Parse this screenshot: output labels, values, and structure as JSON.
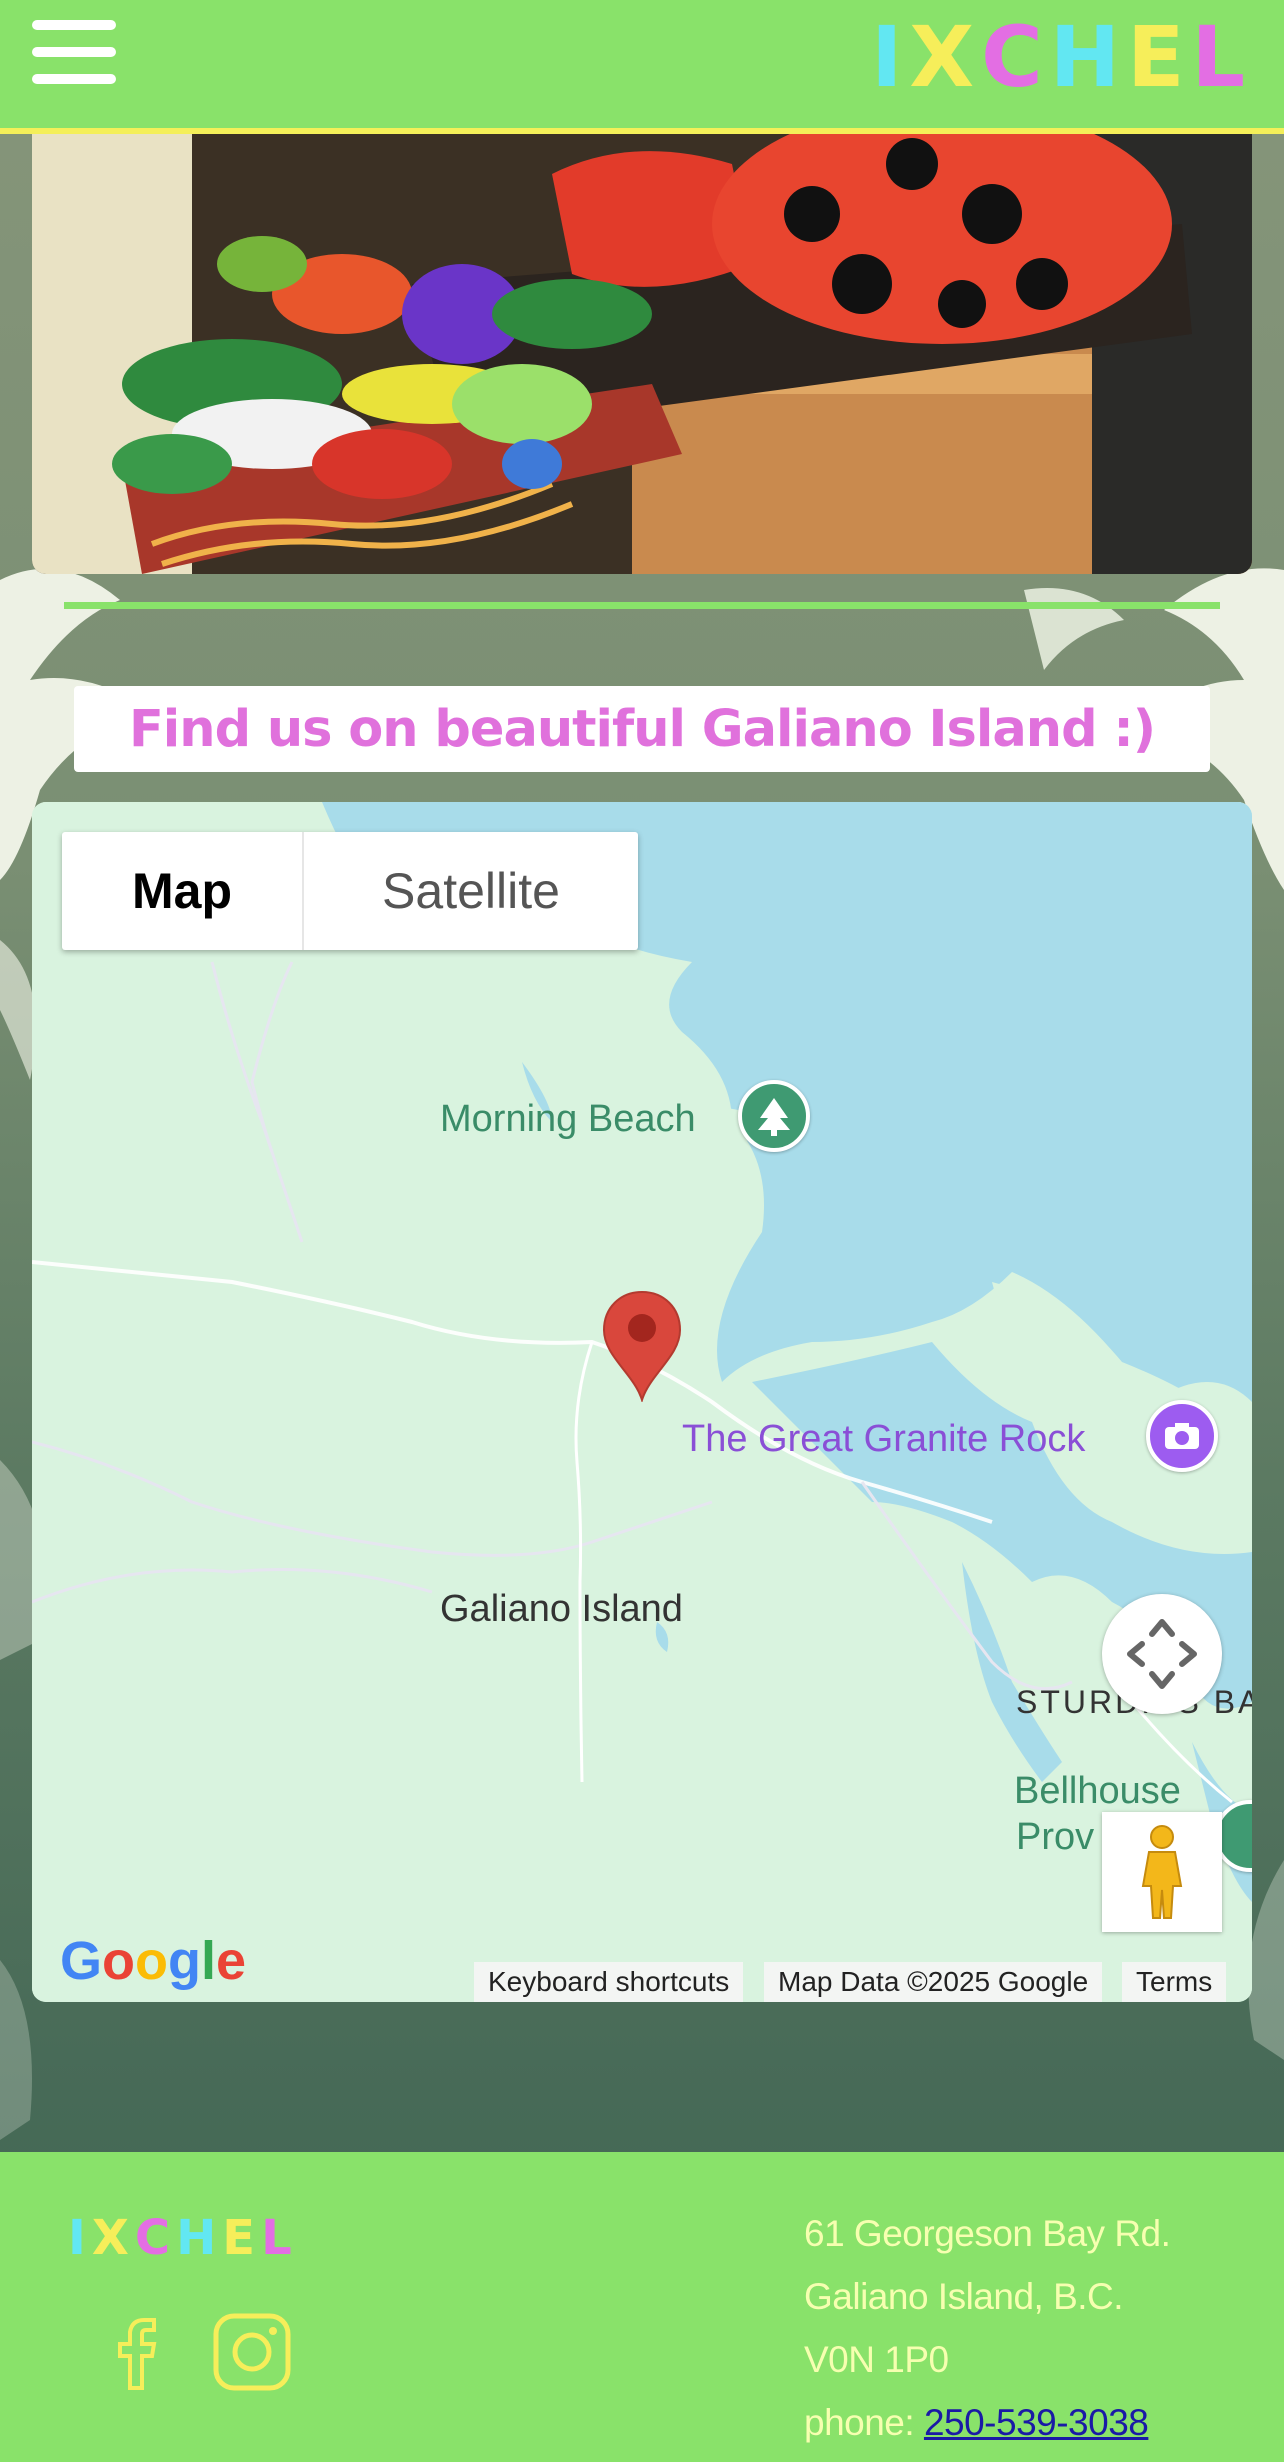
{
  "header": {
    "menu_icon": "hamburger-icon",
    "logo_letters": [
      {
        "char": "I",
        "color": "#62e7f2"
      },
      {
        "char": "X",
        "color": "#f6ee5a"
      },
      {
        "char": "C",
        "color": "#e36ee3"
      },
      {
        "char": "H",
        "color": "#62e7f2"
      },
      {
        "char": "E",
        "color": "#f6ee5a"
      },
      {
        "char": "L",
        "color": "#e36ee3"
      }
    ]
  },
  "hero": {
    "image": "knitted toys in wooden boxes photo"
  },
  "section": {
    "title": "Find us on beautiful Galiano Island :)"
  },
  "map": {
    "type_control": {
      "map_label": "Map",
      "satellite_label": "Satellite",
      "selected": "Map"
    },
    "labels": {
      "morning_beach": "Morning Beach",
      "great_granite_rock": "The Great Granite Rock",
      "galiano_island": "Galiano Island",
      "sturdies_bay": "STURDIES BA",
      "bellhouse_1": "Bellhouse",
      "bellhouse_2": "Prov"
    },
    "logo": "Google",
    "attribution": {
      "shortcuts": "Keyboard shortcuts",
      "data": "Map Data ©2025 Google",
      "terms": "Terms"
    },
    "colors": {
      "water": "#a8dcea",
      "land": "#d9f3df",
      "park": "#3f9a72",
      "poi_purple": "#9d5cf0",
      "marker": "#d9473c"
    }
  },
  "footer": {
    "logo_letters": [
      {
        "char": "I",
        "color": "#62e7f2"
      },
      {
        "char": "X",
        "color": "#f6ee5a"
      },
      {
        "char": "C",
        "color": "#e36ee3"
      },
      {
        "char": "H",
        "color": "#62e7f2"
      },
      {
        "char": "E",
        "color": "#f6ee5a"
      },
      {
        "char": "L",
        "color": "#e36ee3"
      }
    ],
    "address_line1": "61 Georgeson Bay Rd.",
    "address_line2": "Galiano Island, B.C.",
    "address_line3": "V0N 1P0",
    "phone_label": "phone: ",
    "phone": "250-539-3038",
    "social": [
      "facebook-icon",
      "instagram-icon"
    ]
  }
}
